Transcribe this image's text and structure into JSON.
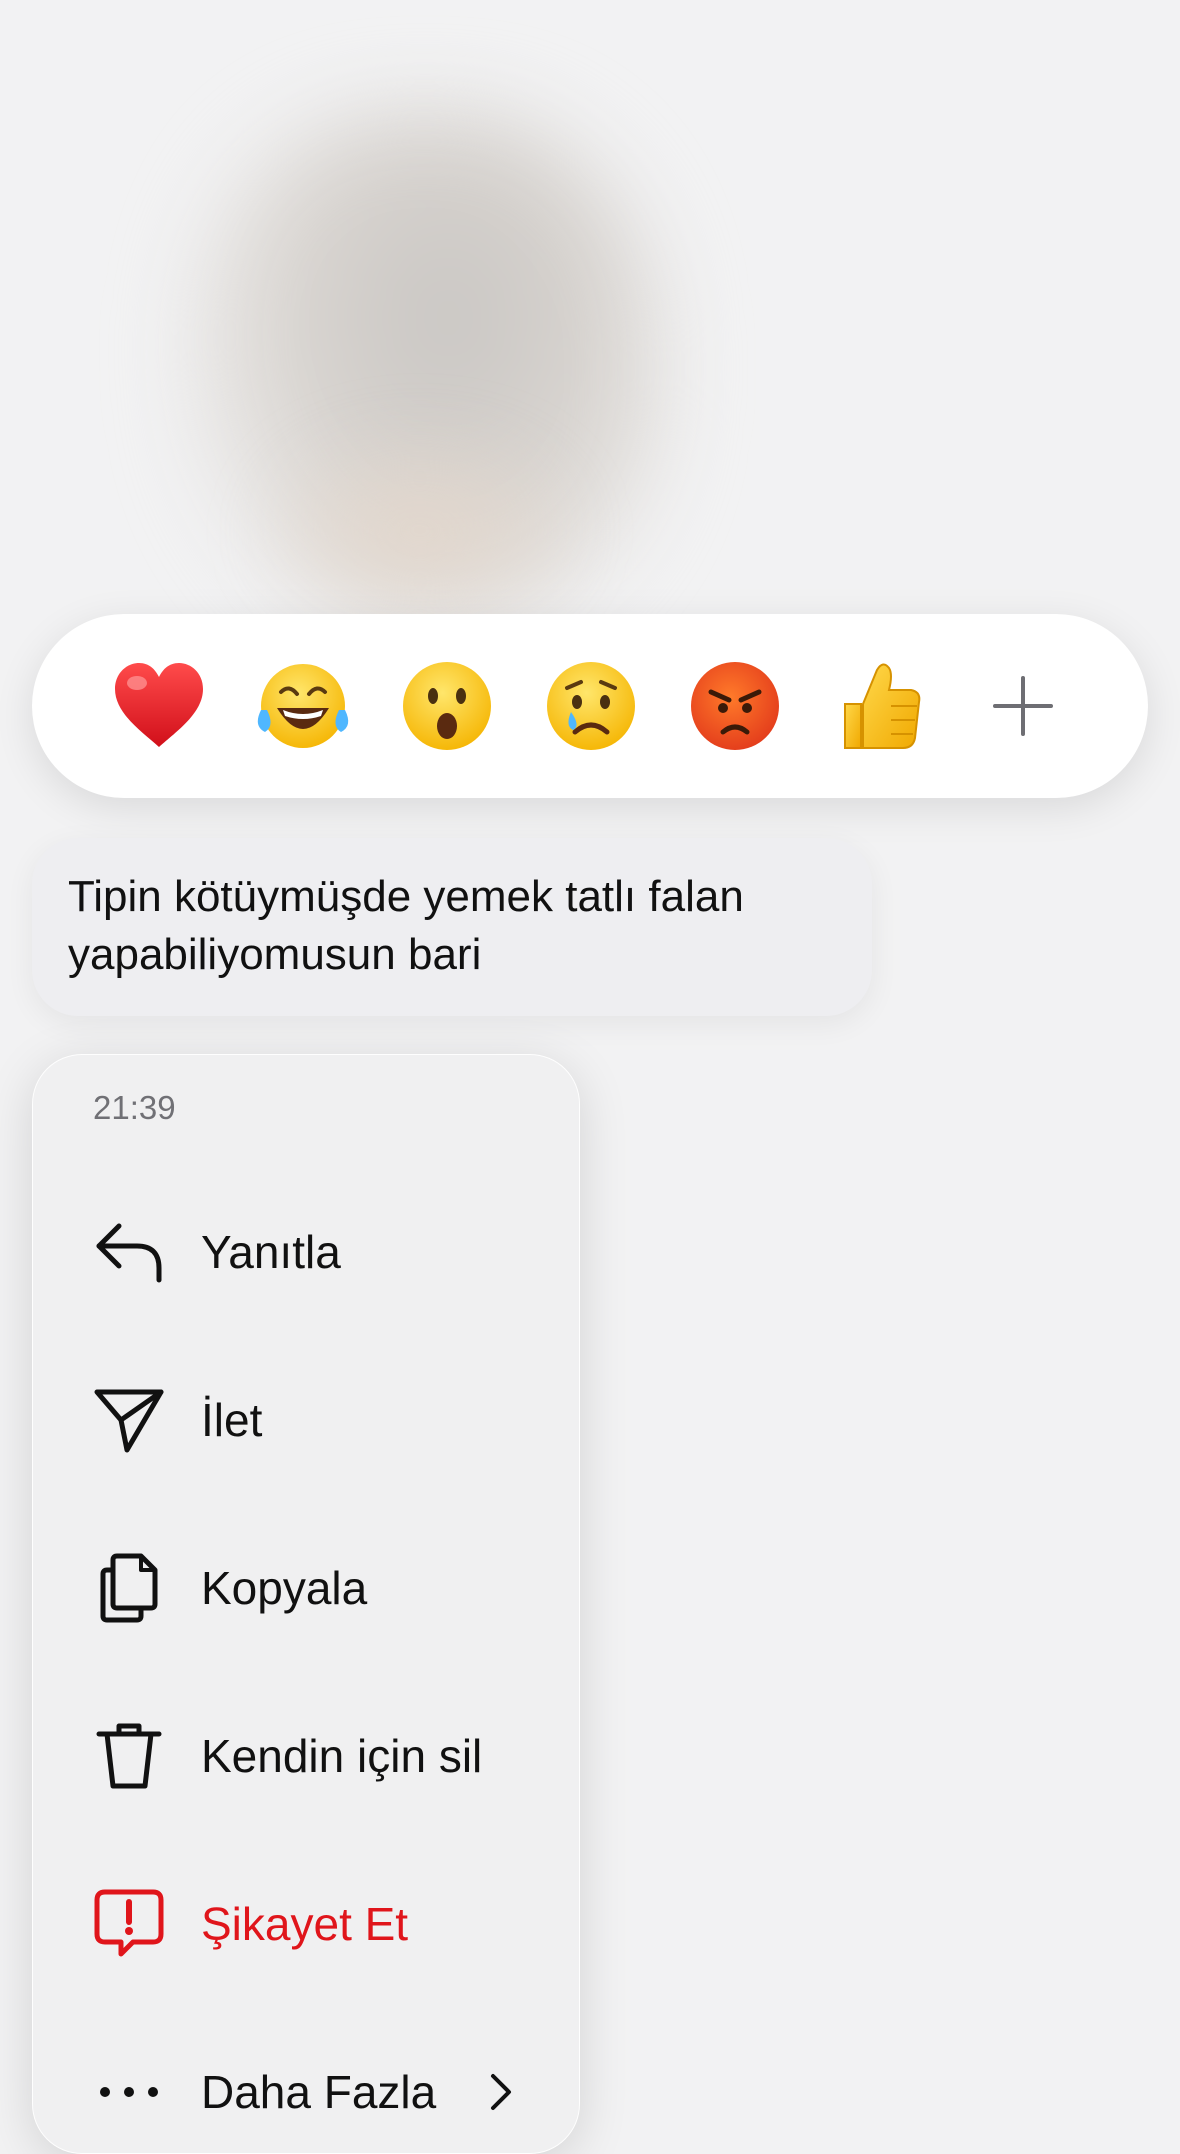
{
  "reactions": [
    {
      "emoji": "❤️",
      "name": "red-heart"
    },
    {
      "emoji": "😂",
      "name": "tears-of-joy"
    },
    {
      "emoji": "😮",
      "name": "open-mouth"
    },
    {
      "emoji": "😢",
      "name": "crying"
    },
    {
      "emoji": "😡",
      "name": "angry"
    },
    {
      "emoji": "👍",
      "name": "thumbs-up"
    },
    {
      "emoji": "+",
      "name": "add-reaction"
    }
  ],
  "message": {
    "text_line1": "Tipin kötüymüşde yemek tatlı falan",
    "text_line2": "yapabiliyomusun bari"
  },
  "menu": {
    "time": "21:39",
    "items": [
      {
        "label": "Yanıtla",
        "icon": "reply-icon"
      },
      {
        "label": "İlet",
        "icon": "send-icon"
      },
      {
        "label": "Kopyala",
        "icon": "copy-icon"
      },
      {
        "label": "Kendin için sil",
        "icon": "trash-icon"
      },
      {
        "label": "Şikayet Et",
        "icon": "report-icon"
      },
      {
        "label": "Daha Fazla",
        "icon": "more-icon"
      }
    ]
  },
  "colors": {
    "danger": "#e0151b",
    "menu_bg": "#f0f0f1",
    "bubble_bg": "#eeeef1"
  }
}
